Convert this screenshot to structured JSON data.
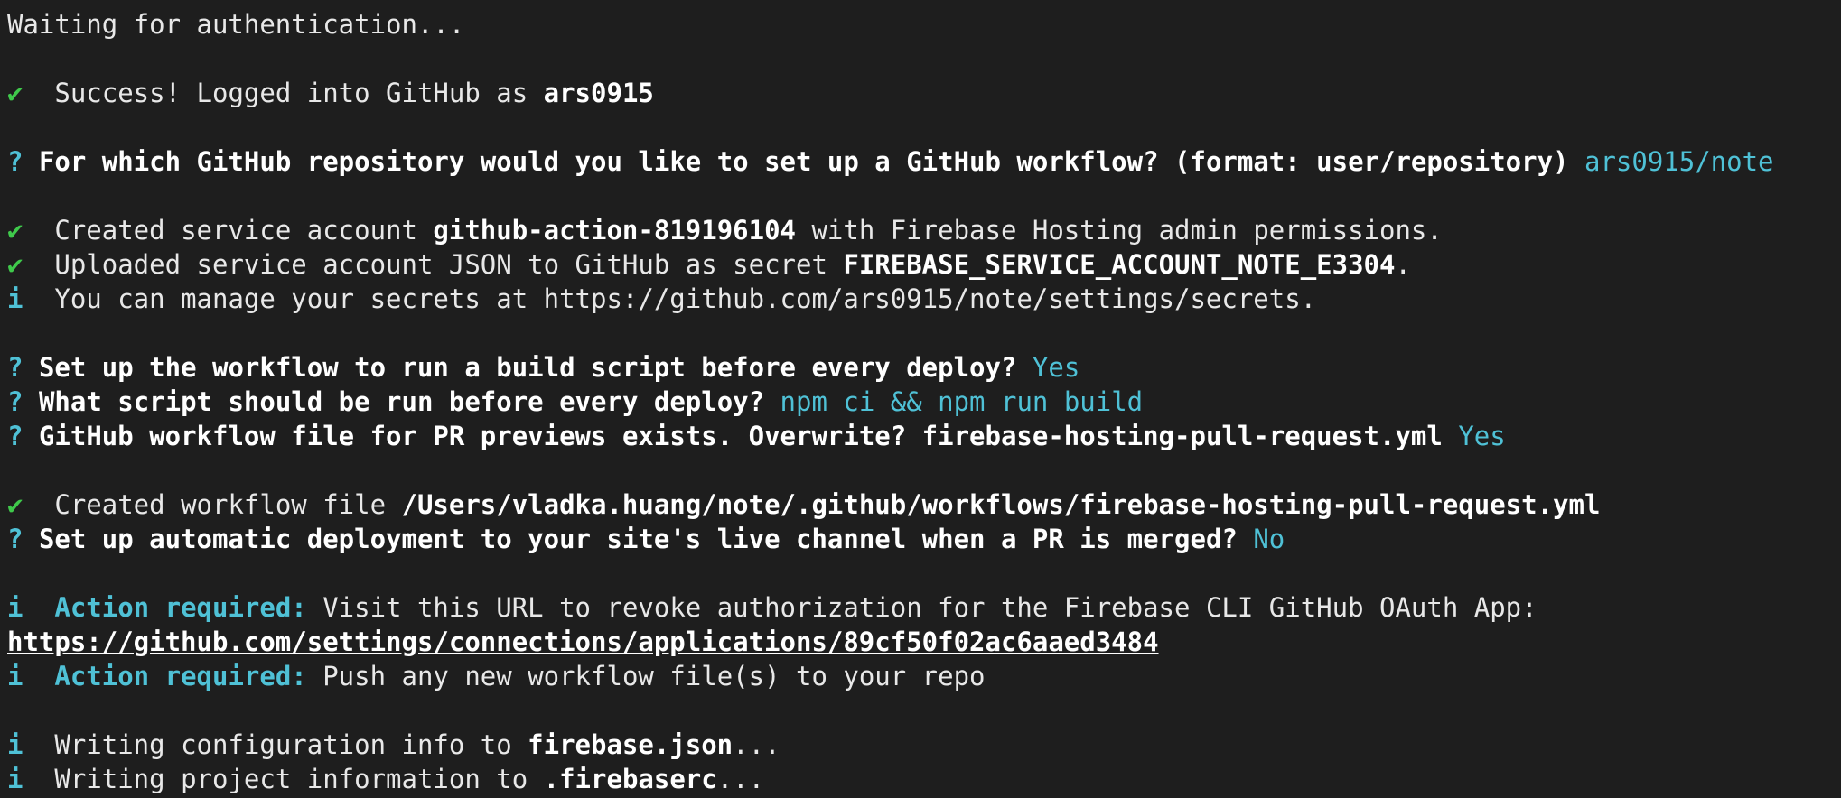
{
  "terminal": {
    "line1": "Waiting for authentication...",
    "success_mark": "✔",
    "success_text": "  Success! Logged into GitHub as ",
    "github_user": "ars0915",
    "q_mark": "?",
    "q_repo": "For which GitHub repository would you like to set up a GitHub workflow? (format: user/repository)",
    "a_repo": "ars0915/note",
    "created_sa_prefix": "  Created service account ",
    "created_sa_name": "github-action-819196104",
    "created_sa_suffix": " with Firebase Hosting admin permissions.",
    "uploaded_prefix": "  Uploaded service account JSON to GitHub as secret ",
    "uploaded_secret": "FIREBASE_SERVICE_ACCOUNT_NOTE_E3304",
    "uploaded_suffix": ".",
    "info_mark": "i",
    "manage_text": "  You can manage your secrets at https://github.com/ars0915/note/settings/secrets.",
    "q_build": "Set up the workflow to run a build script before every deploy?",
    "a_build": "Yes",
    "q_script": "What script should be run before every deploy?",
    "a_script": "npm ci && npm run build",
    "q_overwrite": "GitHub workflow file for PR previews exists. Overwrite? firebase-hosting-pull-request.yml",
    "a_overwrite": "Yes",
    "created_wf_prefix": "  Created workflow file ",
    "created_wf_path": "/Users/vladka.huang/note/.github/workflows/firebase-hosting-pull-request.yml",
    "q_auto": "Set up automatic deployment to your site's live channel when a PR is merged?",
    "a_auto": "No",
    "action_label": "  Action required:",
    "action1_text": " Visit this URL to revoke authorization for the Firebase CLI GitHub OAuth App:",
    "action1_url": "https://github.com/settings/connections/applications/89cf50f02ac6aaed3484",
    "action2_text": " Push any new workflow file(s) to your repo",
    "write_config_prefix": "  Writing configuration info to ",
    "write_config_file": "firebase.json",
    "write_config_suffix": "...",
    "write_project_prefix": "  Writing project information to ",
    "write_project_file": ".firebaserc",
    "write_project_suffix": "..."
  }
}
